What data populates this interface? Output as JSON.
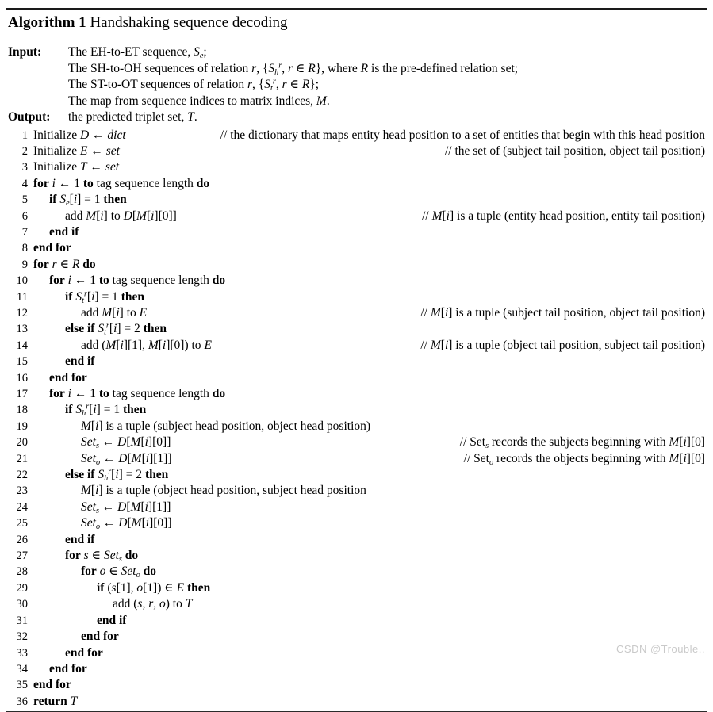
{
  "title": {
    "label": "Algorithm 1",
    "caption": "Handshaking sequence decoding"
  },
  "io": {
    "input_label": "Input:",
    "output_label": "Output:",
    "input_lines": [
      "The EH-to-ET sequence, S_e;",
      "The SH-to-OH sequences of relation r, {S^r_h, r ∈ R}, where R is the pre-defined relation set;",
      "The ST-to-OT sequences of relation r, {S^r_t, r ∈ R};",
      "The map from sequence indices to matrix indices, M."
    ],
    "output_line": "the predicted triplet set, T."
  },
  "lines": [
    {
      "n": "1",
      "indent": 1,
      "code": "Initialize D ← dict",
      "comment": "// the dictionary that maps entity head position to a set of entities that begin with this head position"
    },
    {
      "n": "2",
      "indent": 1,
      "code": "Initialize E ← set",
      "comment": "// the set of (subject tail position, object tail position)"
    },
    {
      "n": "3",
      "indent": 1,
      "code": "Initialize T ← set",
      "comment": ""
    },
    {
      "n": "4",
      "indent": 1,
      "code": "for i ← 1 to tag sequence length do",
      "comment": ""
    },
    {
      "n": "5",
      "indent": 2,
      "code": "if S_e[i] = 1 then",
      "comment": ""
    },
    {
      "n": "6",
      "indent": 3,
      "code": "add M[i] to D[M[i][0]]",
      "comment": "// M[i] is a tuple (entity head position, entity tail position)"
    },
    {
      "n": "7",
      "indent": 2,
      "code": "end if",
      "comment": ""
    },
    {
      "n": "8",
      "indent": 1,
      "code": "end for",
      "comment": ""
    },
    {
      "n": "9",
      "indent": 1,
      "code": "for r ∈ R do",
      "comment": ""
    },
    {
      "n": "10",
      "indent": 2,
      "code": "for i ← 1 to tag sequence length do",
      "comment": ""
    },
    {
      "n": "11",
      "indent": 3,
      "code": "if S^r_t[i] = 1 then",
      "comment": ""
    },
    {
      "n": "12",
      "indent": 4,
      "code": "add M[i] to E",
      "comment": "// M[i] is a tuple (subject tail position, object tail position)"
    },
    {
      "n": "13",
      "indent": 3,
      "code": "else if S^r_t[i] = 2 then",
      "comment": ""
    },
    {
      "n": "14",
      "indent": 4,
      "code": "add (M[i][1], M[i][0]) to E",
      "comment": "// M[i] is a tuple (object tail position, subject tail position)"
    },
    {
      "n": "15",
      "indent": 3,
      "code": "end if",
      "comment": ""
    },
    {
      "n": "16",
      "indent": 2,
      "code": "end for",
      "comment": ""
    },
    {
      "n": "17",
      "indent": 2,
      "code": "for i ← 1 to tag sequence length do",
      "comment": ""
    },
    {
      "n": "18",
      "indent": 3,
      "code": "if S^r_h[i] = 1 then",
      "comment": ""
    },
    {
      "n": "19",
      "indent": 4,
      "code": "M[i] is a tuple (subject head position, object head position)",
      "comment": ""
    },
    {
      "n": "20",
      "indent": 4,
      "code": "Set_s ← D[M[i][0]]",
      "comment": "// Set_s records the subjects beginning with M[i][0]"
    },
    {
      "n": "21",
      "indent": 4,
      "code": "Set_o ← D[M[i][1]]",
      "comment": "// Set_o records the objects beginning with M[i][0]"
    },
    {
      "n": "22",
      "indent": 3,
      "code": "else if S^r_h[i] = 2 then",
      "comment": ""
    },
    {
      "n": "23",
      "indent": 4,
      "code": "M[i] is a tuple (object head position, subject head position",
      "comment": ""
    },
    {
      "n": "24",
      "indent": 4,
      "code": "Set_s ← D[M[i][1]]",
      "comment": ""
    },
    {
      "n": "25",
      "indent": 4,
      "code": "Set_o ← D[M[i][0]]",
      "comment": ""
    },
    {
      "n": "26",
      "indent": 3,
      "code": "end if",
      "comment": ""
    },
    {
      "n": "27",
      "indent": 3,
      "code": "for s ∈ Set_s do",
      "comment": ""
    },
    {
      "n": "28",
      "indent": 4,
      "code": "for o ∈ Set_o do",
      "comment": ""
    },
    {
      "n": "29",
      "indent": 5,
      "code": "if (s[1], o[1]) ∈ E then",
      "comment": ""
    },
    {
      "n": "30",
      "indent": 6,
      "code": "add (s, r, o) to T",
      "comment": ""
    },
    {
      "n": "31",
      "indent": 5,
      "code": "end if",
      "comment": ""
    },
    {
      "n": "32",
      "indent": 4,
      "code": "end for",
      "comment": ""
    },
    {
      "n": "33",
      "indent": 3,
      "code": "end for",
      "comment": ""
    },
    {
      "n": "34",
      "indent": 2,
      "code": "end for",
      "comment": ""
    },
    {
      "n": "35",
      "indent": 1,
      "code": "end for",
      "comment": ""
    },
    {
      "n": "36",
      "indent": 1,
      "code": "return T",
      "comment": ""
    }
  ],
  "watermark": "CSDN @Trouble.."
}
